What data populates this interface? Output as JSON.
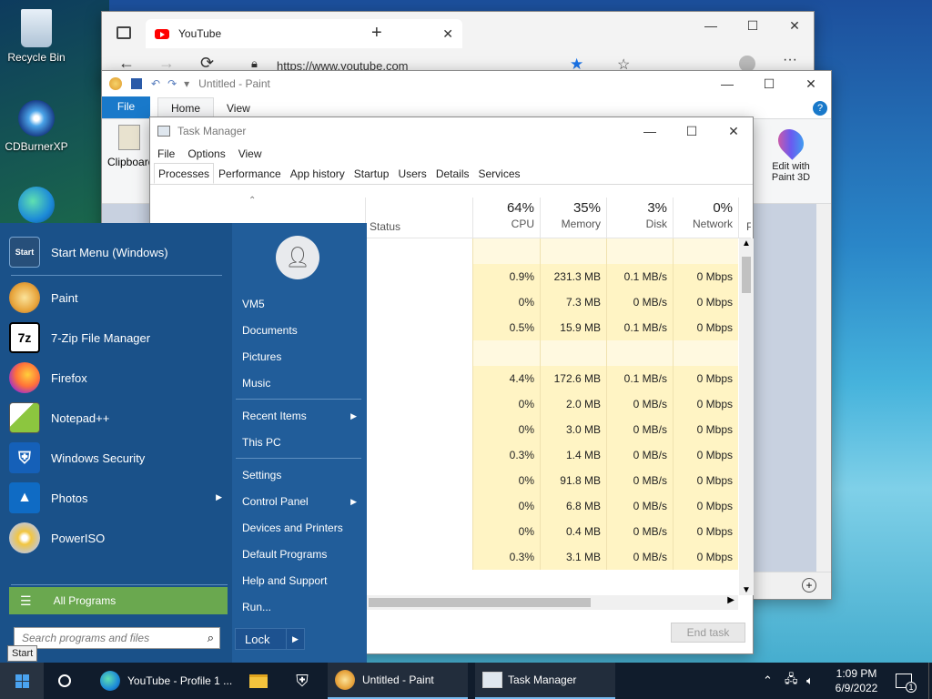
{
  "desktop": {
    "icons": [
      {
        "label": "Recycle Bin"
      },
      {
        "label": "CDBurnerXP"
      }
    ]
  },
  "edge": {
    "tab_title": "YouTube",
    "url": "https://www.youtube.com"
  },
  "paint": {
    "title": "Untitled - Paint",
    "tabs": [
      "File",
      "Home",
      "View"
    ],
    "clipboard_label": "Clipboard",
    "edit3d_line1": "Edit with",
    "edit3d_line2": "Paint 3D"
  },
  "taskmgr": {
    "title": "Task Manager",
    "menu": [
      "File",
      "Options",
      "View"
    ],
    "tabs": [
      "Processes",
      "Performance",
      "App history",
      "Startup",
      "Users",
      "Details",
      "Services"
    ],
    "columns": {
      "status": "Status",
      "cpu": {
        "pct": "64%",
        "label": "CPU"
      },
      "memory": {
        "pct": "35%",
        "label": "Memory"
      },
      "disk": {
        "pct": "3%",
        "label": "Disk"
      },
      "network": {
        "pct": "0%",
        "label": "Network"
      },
      "power": "P"
    },
    "rows": [
      {
        "cpu": "",
        "mem": "",
        "disk": "",
        "net": ""
      },
      {
        "cpu": "0.9%",
        "mem": "231.3 MB",
        "disk": "0.1 MB/s",
        "net": "0 Mbps"
      },
      {
        "cpu": "0%",
        "mem": "7.3 MB",
        "disk": "0 MB/s",
        "net": "0 Mbps"
      },
      {
        "cpu": "0.5%",
        "mem": "15.9 MB",
        "disk": "0.1 MB/s",
        "net": "0 Mbps"
      },
      {
        "cpu": "",
        "mem": "",
        "disk": "",
        "net": ""
      },
      {
        "cpu": "4.4%",
        "mem": "172.6 MB",
        "disk": "0.1 MB/s",
        "net": "0 Mbps"
      },
      {
        "cpu": "0%",
        "mem": "2.0 MB",
        "disk": "0 MB/s",
        "net": "0 Mbps"
      },
      {
        "cpu": "0%",
        "mem": "3.0 MB",
        "disk": "0 MB/s",
        "net": "0 Mbps"
      },
      {
        "cpu": "0.3%",
        "mem": "1.4 MB",
        "disk": "0 MB/s",
        "net": "0 Mbps"
      },
      {
        "cpu": "0%",
        "mem": "91.8 MB",
        "disk": "0 MB/s",
        "net": "0 Mbps"
      },
      {
        "cpu": "0%",
        "mem": "6.8 MB",
        "disk": "0 MB/s",
        "net": "0 Mbps"
      },
      {
        "cpu": "0%",
        "mem": "0.4 MB",
        "disk": "0 MB/s",
        "net": "0 Mbps"
      },
      {
        "cpu": "0.3%",
        "mem": "3.1 MB",
        "disk": "0 MB/s",
        "net": "0 Mbps"
      }
    ],
    "end_task": "End task"
  },
  "startmenu": {
    "programs": [
      {
        "label": "Start Menu (Windows)",
        "icon": "Start"
      },
      {
        "label": "Paint"
      },
      {
        "label": "7-Zip File Manager",
        "icon": "7z"
      },
      {
        "label": "Firefox"
      },
      {
        "label": "Notepad++"
      },
      {
        "label": "Windows Security"
      },
      {
        "label": "Photos"
      },
      {
        "label": "PowerISO"
      }
    ],
    "all_programs": "All Programs",
    "search_placeholder": "Search programs and files",
    "user": "VM5",
    "places": [
      "Documents",
      "Pictures",
      "Music",
      "Recent Items",
      "This PC",
      "Settings",
      "Control Panel",
      "Devices and Printers",
      "Default Programs",
      "Help and Support",
      "Run..."
    ],
    "lock": "Lock",
    "start_tooltip": "Start"
  },
  "taskbar": {
    "items": [
      {
        "label": "YouTube - Profile 1 ..."
      },
      {
        "label": "Untitled - Paint"
      },
      {
        "label": "Task Manager"
      }
    ],
    "time": "1:09 PM",
    "date": "6/9/2022",
    "notif_count": "1"
  }
}
